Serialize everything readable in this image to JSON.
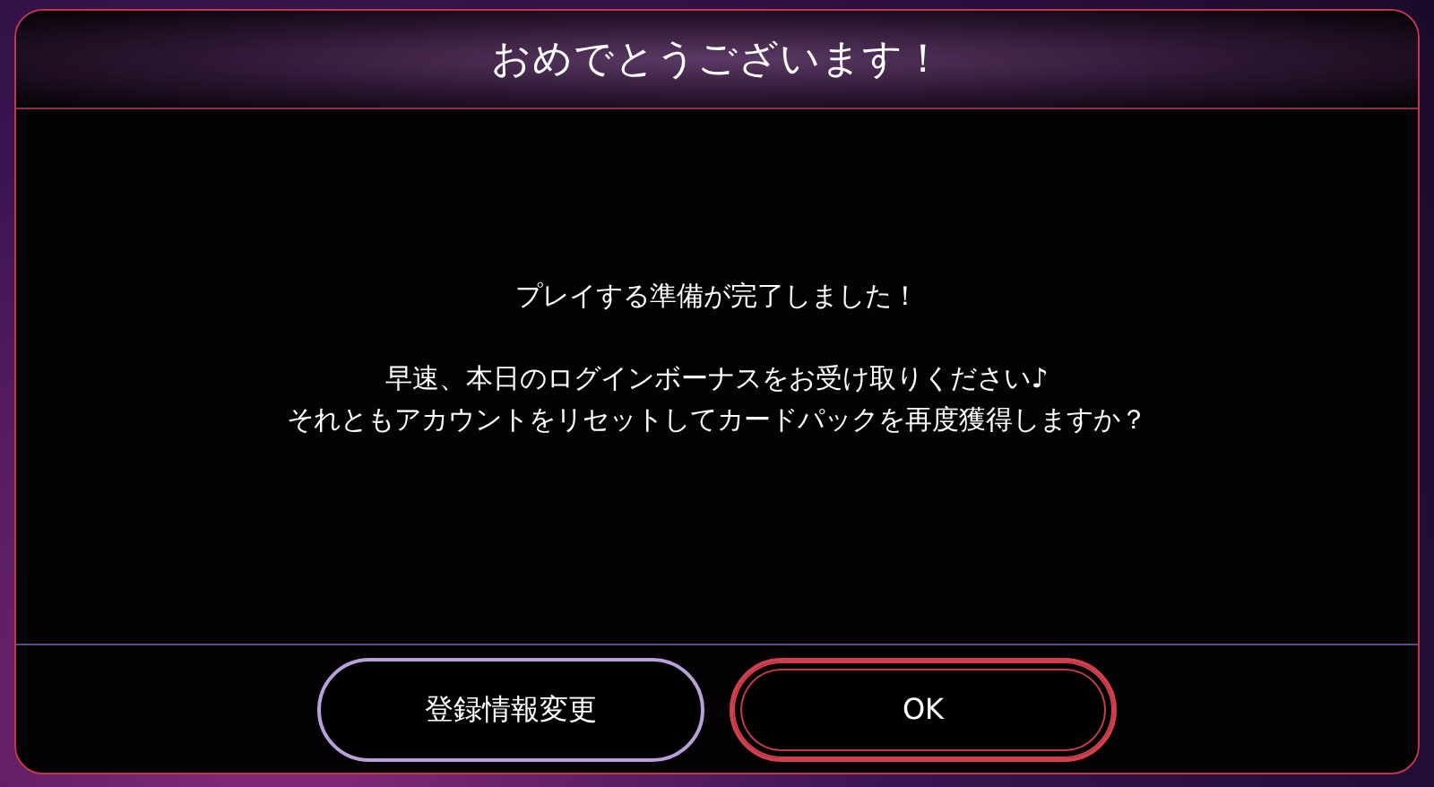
{
  "dialog": {
    "title": "おめでとうございます！",
    "intro": "プレイする準備が完了しました！",
    "message": [
      "早速、本日のログインボーナスをお受け取りください♪",
      "それともアカウントをリセットしてカードパックを再度獲得しますか？"
    ]
  },
  "buttons": [
    {
      "label": "登録情報変更",
      "kind": "secondary"
    },
    {
      "label": "OK",
      "kind": "primary"
    }
  ]
}
